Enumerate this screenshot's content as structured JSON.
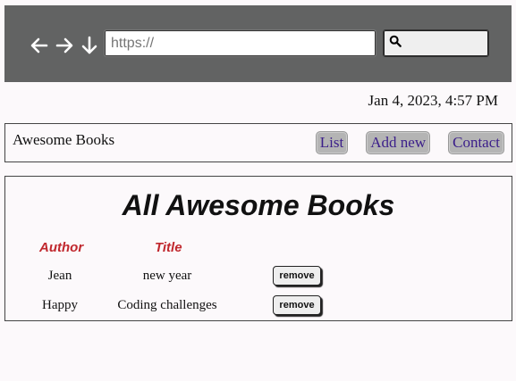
{
  "browser": {
    "url_placeholder": "https://",
    "icons": [
      "arrow-left-icon",
      "arrow-right-icon",
      "arrow-down-icon",
      "search-icon"
    ]
  },
  "datetime": "Jan 4, 2023, 4:57 PM",
  "header": {
    "brand": "Awesome Books",
    "nav": [
      {
        "label": "List"
      },
      {
        "label": "Add new"
      },
      {
        "label": "Contact"
      }
    ]
  },
  "main": {
    "title": "All Awesome Books",
    "columns": {
      "author": "Author",
      "title": "Title"
    },
    "books": [
      {
        "author": "Jean",
        "title": "new year",
        "remove_label": "remove"
      },
      {
        "author": "Happy",
        "title": "Coding challenges",
        "remove_label": "remove"
      }
    ]
  },
  "colors": {
    "toolbar_bg": "#626363",
    "column_header": "#c0272d",
    "nav_text": "#3b1e8a",
    "nav_bg": "#b4b4b4"
  }
}
